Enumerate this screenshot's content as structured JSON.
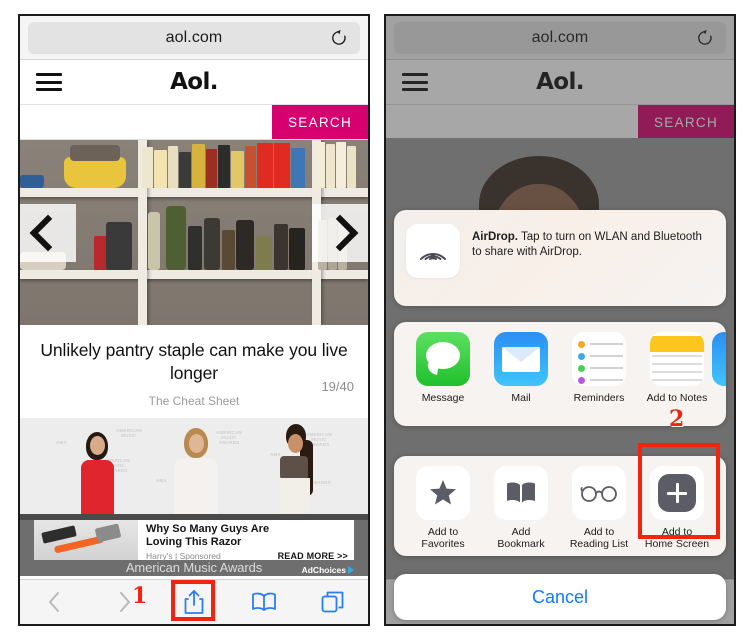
{
  "browser": {
    "url": "aol.com",
    "reload_icon": "reload-icon"
  },
  "site": {
    "logo": "Aol.",
    "menu_icon": "hamburger-menu-icon",
    "search_placeholder": "",
    "search_value": "",
    "search_button": "SEARCH",
    "search_accent": "#d6006e"
  },
  "carousel": {
    "prev_icon": "chevron-left-icon",
    "next_icon": "chevron-right-icon",
    "headline": "Unlikely pantry staple can make you live longer",
    "source": "The Cheat Sheet",
    "counter": "19/40",
    "counter_current": 19,
    "counter_total": 40
  },
  "ad": {
    "title_line1": "Why So Many Guys Are",
    "title_line2": "Loving This Razor",
    "sponsor": "Harry's | Sponsored",
    "cta": "READ MORE >>",
    "adchoices": "AdChoices",
    "caption": "American Music Awards"
  },
  "toolbar": {
    "items": [
      {
        "name": "back-button",
        "icon": "chevron-left-icon",
        "enabled": false
      },
      {
        "name": "forward-button",
        "icon": "chevron-right-icon",
        "enabled": false
      },
      {
        "name": "share-button",
        "icon": "share-icon",
        "enabled": true
      },
      {
        "name": "bookmarks-button",
        "icon": "book-icon",
        "enabled": true
      },
      {
        "name": "tabs-button",
        "icon": "tabs-icon",
        "enabled": true
      }
    ]
  },
  "annotations": {
    "step1": "1",
    "step2": "2",
    "highlight_color": "#f0240f"
  },
  "share_sheet": {
    "airdrop": {
      "icon": "airdrop-icon",
      "bold": "AirDrop.",
      "text": " Tap to turn on WLAN and Bluetooth to share with AirDrop."
    },
    "apps": [
      {
        "label": "Message",
        "icon": "message-icon"
      },
      {
        "label": "Mail",
        "icon": "mail-icon"
      },
      {
        "label": "Reminders",
        "icon": "reminders-icon"
      },
      {
        "label": "Add to Notes",
        "icon": "notes-icon"
      }
    ],
    "actions": [
      {
        "label": "Add to\nFavorites",
        "line1": "Add to",
        "line2": "Favorites",
        "icon": "star-icon"
      },
      {
        "label": "Add Bookmark",
        "line1": "Add",
        "line2": "Bookmark",
        "icon": "book-icon"
      },
      {
        "label": "Add to Reading List",
        "line1": "Add to",
        "line2": "Reading List",
        "icon": "glasses-icon"
      },
      {
        "label": "Add to Home Screen",
        "line1": "Add to",
        "line2": "Home Screen",
        "icon": "plus-square-icon"
      }
    ],
    "cancel": "Cancel"
  }
}
